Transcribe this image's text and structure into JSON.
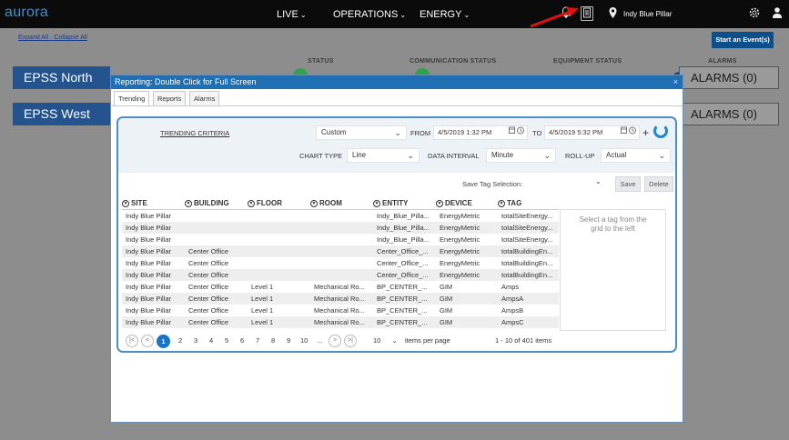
{
  "topbar": {
    "logo": "aurora",
    "nav": [
      {
        "label": "LIVE"
      },
      {
        "label": "OPERATIONS"
      },
      {
        "label": "ENERGY"
      }
    ],
    "site": "Indy Blue Pillar",
    "caret": "⌄"
  },
  "page": {
    "expand_all": "Expand All",
    "collapse_all": "Collapse All",
    "link_sep": "·",
    "start_event": "Start an Event(s)",
    "columns": {
      "status": "STATUS",
      "communication": "COMMUNICATION STATUS",
      "equipment": "EQUIPMENT STATUS",
      "alarms": "ALARMS"
    },
    "regions": [
      {
        "name": "EPSS North",
        "alarms": "ALARMS (0)"
      },
      {
        "name": "EPSS West",
        "alarms": "ALARMS (0)"
      }
    ]
  },
  "modal": {
    "title": "Reporting: Double Click for Full Screen",
    "close": "×",
    "tabs": [
      "Trending",
      "Reports",
      "Alarms"
    ],
    "criteria": {
      "link": "TRENDING CRITERIA",
      "range": "Custom",
      "from_label": "FROM",
      "from_value": "4/5/2019 1:32 PM",
      "to_label": "TO",
      "to_value": "4/5/2019 5:32 PM",
      "chart_type_label": "CHART TYPE",
      "chart_type": "Line",
      "interval_label": "DATA INTERVAL",
      "interval": "Minute",
      "rollup_label": "ROLL-UP",
      "rollup": "Actual"
    },
    "save": {
      "label": "Save Tag Selection:",
      "save_btn": "Save",
      "delete_btn": "Delete"
    },
    "grid": {
      "headers": [
        "SITE",
        "BUILDING",
        "FLOOR",
        "ROOM",
        "ENTITY",
        "DEVICE",
        "TAG"
      ],
      "rows": [
        [
          "Indy Blue Pillar",
          "",
          "",
          "",
          "Indy_Blue_Pilla...",
          "EnergyMetric",
          "totalSiteEnergy..."
        ],
        [
          "Indy Blue Pillar",
          "",
          "",
          "",
          "Indy_Blue_Pilla...",
          "EnergyMetric",
          "totalSiteEnergy..."
        ],
        [
          "Indy Blue Pillar",
          "",
          "",
          "",
          "Indy_Blue_Pilla...",
          "EnergyMetric",
          "totalSiteEnergy..."
        ],
        [
          "Indy Blue Pillar",
          "Center Office",
          "",
          "",
          "Center_Office_...",
          "EnergyMetric",
          "totalBuildingEn..."
        ],
        [
          "Indy Blue Pillar",
          "Center Office",
          "",
          "",
          "Center_Office_...",
          "EnergyMetric",
          "totalBuildingEn..."
        ],
        [
          "Indy Blue Pillar",
          "Center Office",
          "",
          "",
          "Center_Office_...",
          "EnergyMetric",
          "totalBuildingEn..."
        ],
        [
          "Indy Blue Pillar",
          "Center Office",
          "Level 1",
          "Mechanical Ro...",
          "BP_CENTER_...",
          "GIM",
          "Amps"
        ],
        [
          "Indy Blue Pillar",
          "Center Office",
          "Level 1",
          "Mechanical Ro...",
          "BP_CENTER_...",
          "GIM",
          "AmpsA"
        ],
        [
          "Indy Blue Pillar",
          "Center Office",
          "Level 1",
          "Mechanical Ro...",
          "BP_CENTER_...",
          "GIM",
          "AmpsB"
        ],
        [
          "Indy Blue Pillar",
          "Center Office",
          "Level 1",
          "Mechanical Ro...",
          "BP_CENTER_...",
          "GIM",
          "AmpsC"
        ]
      ],
      "tag_hint": "Select a tag from the grid to the left"
    },
    "pager": {
      "pages": [
        "1",
        "2",
        "3",
        "4",
        "5",
        "6",
        "7",
        "8",
        "9",
        "10",
        "..."
      ],
      "current": "1",
      "first": "|<",
      "prev": "<",
      "next": ">",
      "last": ">|",
      "page_size": "10",
      "items_per_page": "items per page",
      "summary": "1 - 10 of 401 items"
    }
  }
}
